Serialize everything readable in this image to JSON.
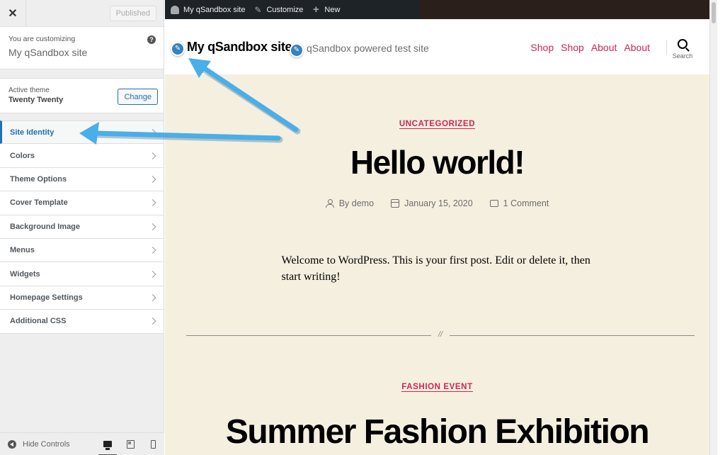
{
  "sidebar": {
    "close_icon": "✕",
    "published_label": "Published",
    "customizing_label": "You are customizing",
    "site_name": "My qSandbox site",
    "help_icon": "?",
    "active_theme_label": "Active theme",
    "theme_name": "Twenty Twenty",
    "change_label": "Change",
    "items": [
      {
        "label": "Site Identity",
        "active": true
      },
      {
        "label": "Colors"
      },
      {
        "label": "Theme Options"
      },
      {
        "label": "Cover Template"
      },
      {
        "label": "Background Image"
      },
      {
        "label": "Menus"
      },
      {
        "label": "Widgets"
      },
      {
        "label": "Homepage Settings"
      },
      {
        "label": "Additional CSS"
      }
    ],
    "footer": {
      "hide_controls_label": "Hide Controls",
      "devices": [
        "desktop",
        "tablet",
        "mobile"
      ],
      "active_device": "desktop"
    }
  },
  "adminbar": {
    "site_label": "My qSandbox site",
    "customize_label": "Customize",
    "new_label": "New",
    "new_icon": "+",
    "customize_icon": "🖌"
  },
  "site": {
    "title": "My qSandbox site",
    "description": "qSandbox powered test site",
    "edit_icon": "✎",
    "nav": [
      "Shop",
      "Shop",
      "About",
      "About"
    ],
    "search_label": "Search"
  },
  "posts": [
    {
      "category": "UNCATEGORIZED",
      "title": "Hello world!",
      "author": "By demo",
      "date": "January 15, 2020",
      "comments": "1 Comment",
      "excerpt": "Welcome to WordPress. This is your first post. Edit or delete it, then start writing!"
    },
    {
      "category": "FASHION EVENT",
      "title": "Summer Fashion Exhibition"
    }
  ],
  "divider_mark": "//",
  "colors": {
    "accent": "#cd2653",
    "wp_blue": "#2271b1",
    "annotation_arrow": "#4aaee8",
    "preview_bg": "#f5efe0",
    "adminbar_bg": "#1d2327"
  }
}
